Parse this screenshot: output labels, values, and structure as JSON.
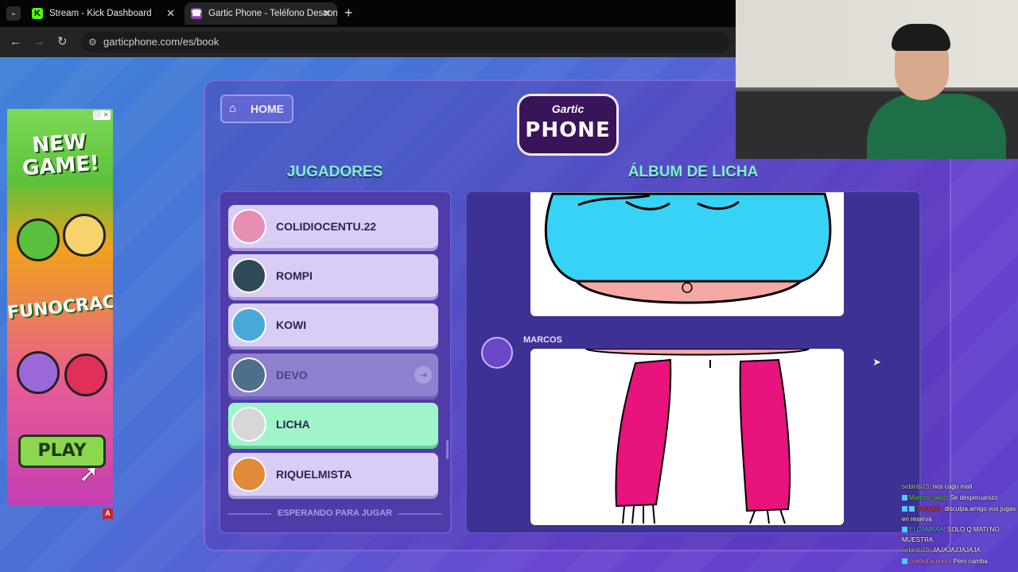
{
  "browser": {
    "tabs": [
      {
        "label": "Stream - Kick Dashboard",
        "icon": "K",
        "active": false
      },
      {
        "label": "Gartic Phone - Teléfono Descon",
        "icon": "☎",
        "active": true
      }
    ],
    "url": "garticphone.com/es/book"
  },
  "ad": {
    "headline": "NEW GAME!",
    "brand": "FUNOCRACY",
    "cta": "PLAY",
    "badge": "A"
  },
  "game": {
    "home_label": "HOME",
    "logo_top": "Gartic",
    "logo_bottom": "PHONE",
    "players_title": "JUGADORES",
    "album_title": "ÁLBUM DE LICHA",
    "players": [
      {
        "name": "COLIDIOCENTU.22",
        "state": "normal",
        "avatar_color": "#e78fb3"
      },
      {
        "name": "ROMPI",
        "state": "normal",
        "avatar_color": "#2f4b57"
      },
      {
        "name": "KOWI",
        "state": "normal",
        "avatar_color": "#4aa8d8"
      },
      {
        "name": "DEVO",
        "state": "away",
        "avatar_color": "#4c6f8a"
      },
      {
        "name": "LICHA",
        "state": "active",
        "avatar_color": "#d7d7d7"
      },
      {
        "name": "RIQUELMISTA",
        "state": "normal",
        "avatar_color": "#e08a3a"
      }
    ],
    "waiting_label": "ESPERANDO PARA JUGAR",
    "album_author": "MARCOS"
  },
  "chat": [
    {
      "user": "sebinbi23",
      "text": "nos cago mati",
      "color": "#c7c7c7"
    },
    {
      "user": "Marcos_okss",
      "text": "Se desperuanizo",
      "color": "#53fc18"
    },
    {
      "user": "Pumpkin",
      "text": "disculpa.amigo vos jugas en reserva",
      "color": "#ff4d4d"
    },
    {
      "user": "ELCAMBAA",
      "text": "SOLO Q MATI NO MUESTRA",
      "color": "#53c8ff"
    },
    {
      "user": "sebinbi23",
      "text": "JAJAJAJJAJAJA",
      "color": "#c7c7c7"
    },
    {
      "user": "colidiofacundo",
      "text": "Pero camba",
      "color": "#ff9ad5"
    }
  ]
}
